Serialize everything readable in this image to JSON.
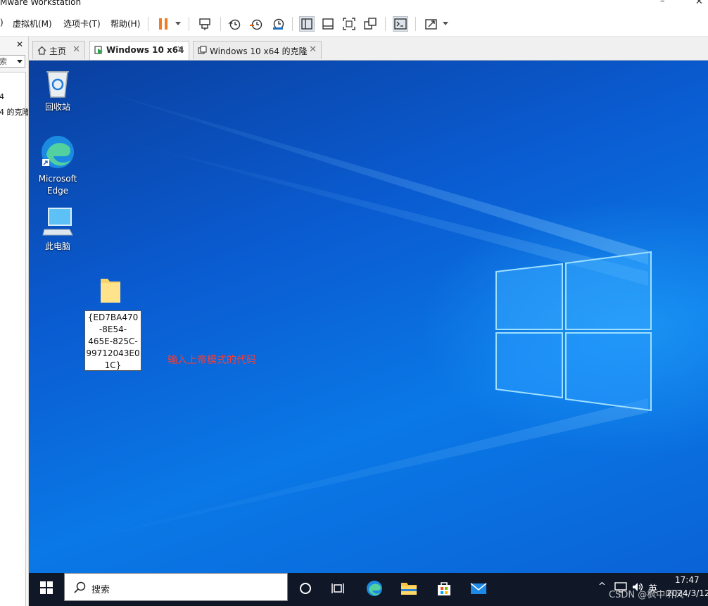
{
  "window": {
    "title": "Mware Workstation",
    "minimize_glyph": "–",
    "close_glyph": "✕"
  },
  "menubar": {
    "items": [
      {
        "label": ")"
      },
      {
        "label": "虚拟机(M)"
      },
      {
        "label": "选项卡(T)"
      },
      {
        "label": "帮助(H)"
      }
    ]
  },
  "toolbar": {
    "icons": [
      "pause-icon",
      "send-ctrl-alt-del-icon",
      "snapshot-icon",
      "revert-snapshot-icon",
      "snapshot-manager-icon",
      "library-view-icon",
      "thumbnail-view-icon",
      "fullscreen-icon",
      "unity-icon",
      "console-icon",
      "stretch-icon"
    ],
    "accent_color": "#f47b20"
  },
  "sidebar": {
    "close_glyph": "✕",
    "search_text": "索",
    "tree_items": [
      {
        "label": "4"
      },
      {
        "label": "4 的克隆"
      }
    ]
  },
  "tabs": [
    {
      "label": "主页",
      "icon": "home-icon",
      "active": false
    },
    {
      "label": "Windows 10 x64",
      "icon": "vm-running-icon",
      "active": true
    },
    {
      "label": "Windows 10 x64 的克隆",
      "icon": "vm-icon",
      "active": false
    }
  ],
  "tab_close_glyph": "✕",
  "desktop": {
    "icons": [
      {
        "name": "recycle-bin",
        "label": "回收站"
      },
      {
        "name": "microsoft-edge",
        "label": "Microsoft\nEdge"
      },
      {
        "name": "this-pc",
        "label": "此电脑"
      }
    ],
    "rename_lines": [
      "{ED7BA470",
      "-8E54-",
      "465E-825C-",
      "99712043E0",
      "1C}"
    ],
    "annotation": "输入上帝模式的代码",
    "annotation_color": "#ff3b30"
  },
  "taskbar": {
    "search_placeholder": "搜索",
    "pinned": [
      "task-view-icon",
      "cortana-icon",
      "edge-icon",
      "file-explorer-icon",
      "store-icon",
      "mail-icon"
    ],
    "tray_chevron": "^",
    "ime": "英",
    "time": "17:47",
    "date": "2024/3/12"
  },
  "watermark": "CSDN @枫中听风"
}
